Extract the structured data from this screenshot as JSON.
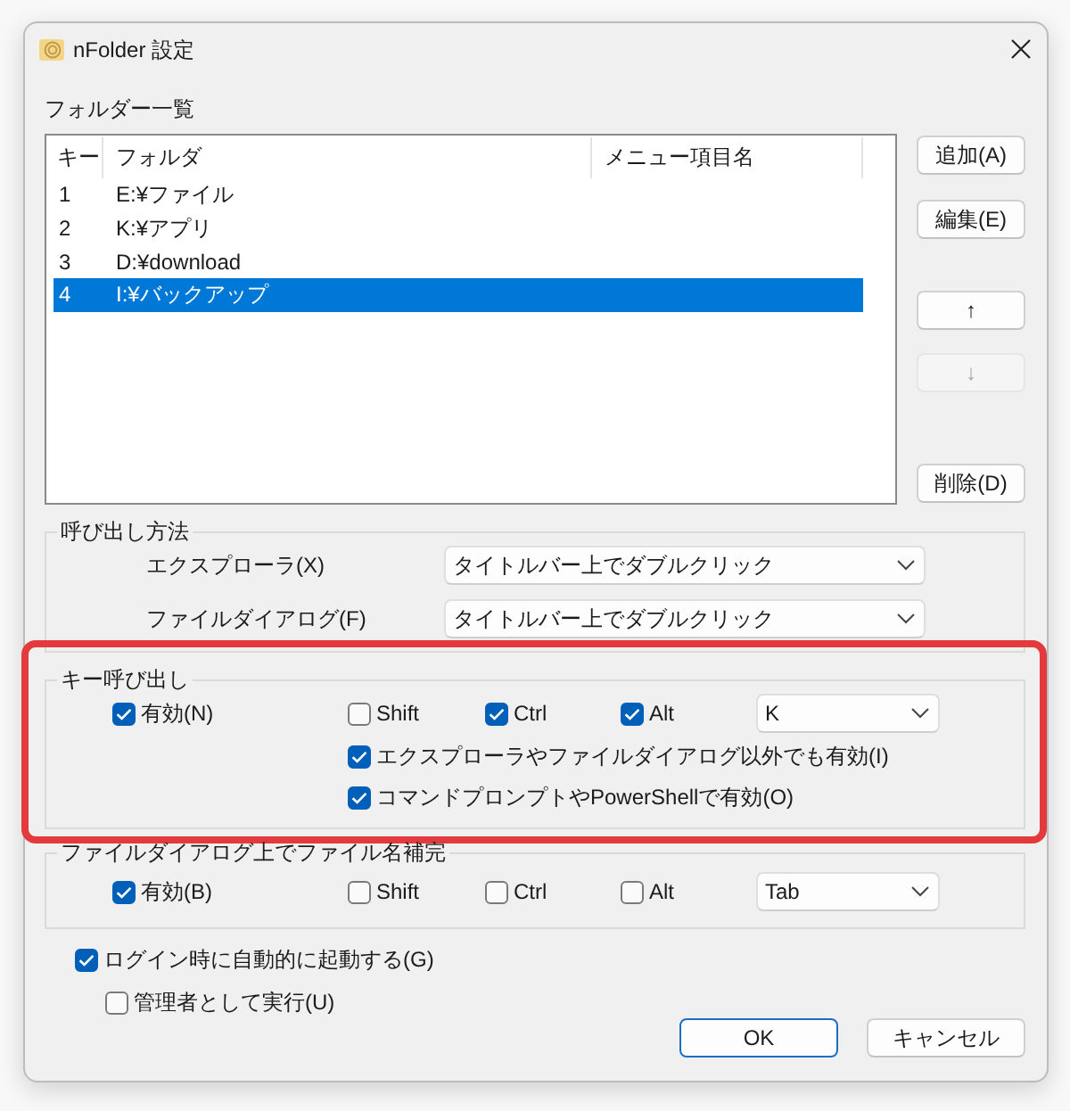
{
  "window": {
    "title": "nFolder 設定"
  },
  "folder_list": {
    "label": "フォルダー一覧",
    "columns": [
      "キー",
      "フォルダ",
      "メニュー項目名"
    ],
    "rows": [
      {
        "key": "1",
        "folder": "E:¥ファイル",
        "selected": false
      },
      {
        "key": "2",
        "folder": "K:¥アプリ",
        "selected": false
      },
      {
        "key": "3",
        "folder": "D:¥download",
        "selected": false
      },
      {
        "key": "4",
        "folder": "I:¥バックアップ",
        "selected": true
      }
    ]
  },
  "list_buttons": [
    {
      "label": "追加(A)",
      "disabled": false
    },
    {
      "label": "編集(E)",
      "disabled": false
    },
    {
      "label": "↑",
      "disabled": false
    },
    {
      "label": "↓",
      "disabled": true
    },
    {
      "label": "削除(D)",
      "disabled": false
    }
  ],
  "invoke_method": {
    "label": "呼び出し方法",
    "highlighted": false,
    "rows": [
      {
        "label": "エクスプローラ(X)",
        "value": "タイトルバー上でダブルクリック"
      },
      {
        "label": "ファイルダイアログ(F)",
        "value": "タイトルバー上でダブルクリック"
      }
    ]
  },
  "key_invoke": {
    "label": "キー呼び出し",
    "highlighted": true,
    "enabled": {
      "label": "有効(N)",
      "checked": true
    },
    "modifiers": [
      {
        "label": "Shift",
        "checked": false
      },
      {
        "label": "Ctrl",
        "checked": true
      },
      {
        "label": "Alt",
        "checked": true
      }
    ],
    "key": "K",
    "options": [
      {
        "label": "エクスプローラやファイルダイアログ以外でも有効(I)",
        "checked": true
      },
      {
        "label": "コマンドプロンプトやPowerShellで有効(O)",
        "checked": true
      }
    ]
  },
  "completion": {
    "label": "ファイルダイアログ上でファイル名補完",
    "highlighted": false,
    "enabled": {
      "label": "有効(B)",
      "checked": true
    },
    "modifiers": [
      {
        "label": "Shift",
        "checked": false
      },
      {
        "label": "Ctrl",
        "checked": false
      },
      {
        "label": "Alt",
        "checked": false
      }
    ],
    "key": "Tab"
  },
  "startup": [
    {
      "label": "ログイン時に自動的に起動する(G)",
      "checked": true,
      "children": [
        {
          "label": "管理者として実行(U)",
          "checked": false
        }
      ]
    }
  ],
  "buttons": [
    {
      "label": "OK",
      "default": true
    },
    {
      "label": "キャンセル",
      "default": false
    }
  ]
}
